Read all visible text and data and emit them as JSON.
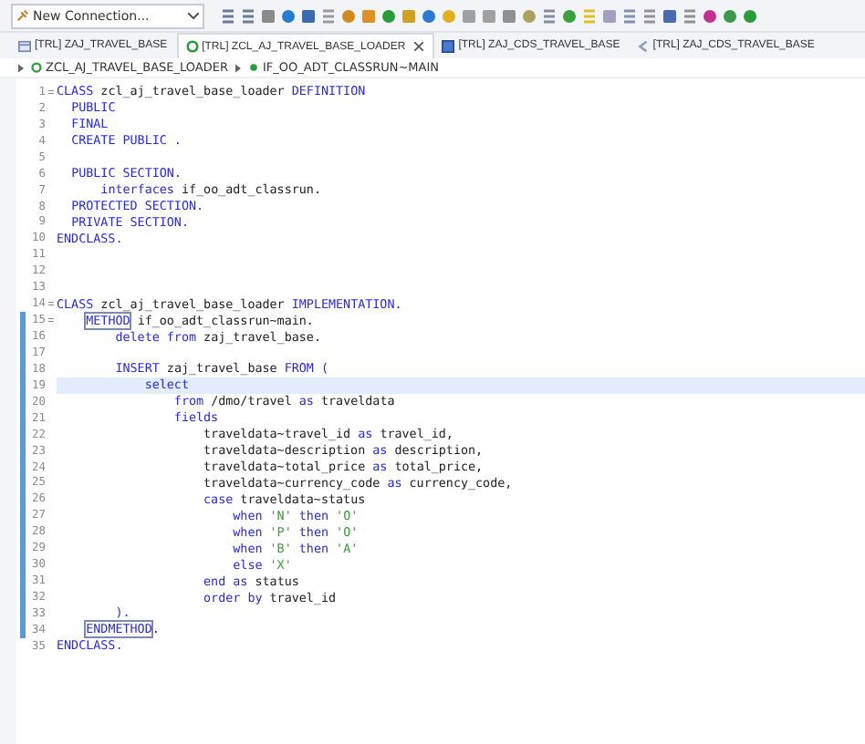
{
  "toolbar": {
    "connection": {
      "value": "New Connection..."
    }
  },
  "tabs": [
    {
      "label": "[TRL] ZAJ_TRAVEL_BASE",
      "kind": "table",
      "selected": false,
      "closable": false
    },
    {
      "label": "[TRL] ZCL_AJ_TRAVEL_BASE_LOADER",
      "kind": "class",
      "selected": true,
      "closable": true
    },
    {
      "label": "[TRL] ZAJ_CDS_TRAVEL_BASE",
      "kind": "cds",
      "selected": false,
      "closable": false
    },
    {
      "label": "[TRL] ZAJ_CDS_TRAVEL_BASE",
      "kind": "extension",
      "selected": false,
      "closable": false
    }
  ],
  "breadcrumb": [
    {
      "label": "ZCL_AJ_TRAVEL_BASE_LOADER",
      "kind": "class"
    },
    {
      "label": "IF_OO_ADT_CLASSRUN~MAIN",
      "kind": "method"
    }
  ],
  "editor": {
    "lines": [
      {
        "number": "1",
        "fold": true,
        "changed": false,
        "current": false,
        "tokens": [
          {
            "kind": "keyword",
            "text": "CLASS"
          },
          {
            "kind": "name",
            "text": " zcl_aj_travel_base_loader "
          },
          {
            "kind": "keyword",
            "text": "DEFINITION"
          }
        ]
      },
      {
        "number": "2",
        "fold": false,
        "changed": false,
        "current": false,
        "tokens": [
          {
            "kind": "keyword",
            "text": "  PUBLIC"
          }
        ]
      },
      {
        "number": "3",
        "fold": false,
        "changed": false,
        "current": false,
        "tokens": [
          {
            "kind": "keyword",
            "text": "  FINAL"
          }
        ]
      },
      {
        "number": "4",
        "fold": false,
        "changed": false,
        "current": false,
        "tokens": [
          {
            "kind": "keyword",
            "text": "  CREATE PUBLIC ."
          }
        ]
      },
      {
        "number": "5",
        "fold": false,
        "changed": false,
        "current": false
      },
      {
        "number": "6",
        "fold": false,
        "changed": false,
        "current": false,
        "tokens": [
          {
            "kind": "keyword",
            "text": "  PUBLIC SECTION."
          }
        ]
      },
      {
        "number": "7",
        "fold": false,
        "changed": false,
        "current": false,
        "tokens": [
          {
            "kind": "keyword",
            "text": "      interfaces"
          },
          {
            "kind": "name",
            "text": " if_oo_adt_classrun."
          }
        ]
      },
      {
        "number": "8",
        "fold": false,
        "changed": false,
        "current": false,
        "tokens": [
          {
            "kind": "keyword",
            "text": "  PROTECTED SECTION."
          }
        ]
      },
      {
        "number": "9",
        "fold": false,
        "changed": false,
        "current": false,
        "tokens": [
          {
            "kind": "keyword",
            "text": "  PRIVATE SECTION."
          }
        ]
      },
      {
        "number": "10",
        "fold": false,
        "changed": false,
        "current": false,
        "tokens": [
          {
            "kind": "keyword",
            "text": "ENDCLASS."
          }
        ]
      },
      {
        "number": "11",
        "fold": false,
        "changed": false,
        "current": false
      },
      {
        "number": "12",
        "fold": false,
        "changed": false,
        "current": false
      },
      {
        "number": "13",
        "fold": false,
        "changed": false,
        "current": false
      },
      {
        "number": "14",
        "fold": true,
        "changed": false,
        "current": false,
        "tokens": [
          {
            "kind": "keyword",
            "text": "CLASS"
          },
          {
            "kind": "name",
            "text": " zcl_aj_travel_base_loader "
          },
          {
            "kind": "keyword",
            "text": "IMPLEMENTATION."
          }
        ]
      },
      {
        "number": "15",
        "fold": true,
        "changed": true,
        "current": false,
        "tokens": [
          {
            "kind": "match",
            "text": "    METHOD"
          },
          {
            "kind": "name",
            "text": " if_oo_adt_classrun~main."
          }
        ]
      },
      {
        "number": "16",
        "fold": false,
        "changed": true,
        "current": false,
        "tokens": [
          {
            "kind": "keyword",
            "text": "        delete from"
          },
          {
            "kind": "name",
            "text": " zaj_travel_base."
          }
        ]
      },
      {
        "number": "17",
        "fold": false,
        "changed": true,
        "current": false
      },
      {
        "number": "18",
        "fold": false,
        "changed": true,
        "current": false,
        "tokens": [
          {
            "kind": "keyword",
            "text": "        INSERT"
          },
          {
            "kind": "name",
            "text": " zaj_travel_base "
          },
          {
            "kind": "keyword",
            "text": "FROM ("
          }
        ]
      },
      {
        "number": "19",
        "fold": false,
        "changed": true,
        "current": true,
        "tokens": [
          {
            "kind": "keyword",
            "text": "            select"
          }
        ]
      },
      {
        "number": "20",
        "fold": false,
        "changed": true,
        "current": false,
        "tokens": [
          {
            "kind": "keyword",
            "text": "                from"
          },
          {
            "kind": "name",
            "text": " /dmo/travel "
          },
          {
            "kind": "keyword",
            "text": "as"
          },
          {
            "kind": "name",
            "text": " traveldata"
          }
        ]
      },
      {
        "number": "21",
        "fold": false,
        "changed": true,
        "current": false,
        "tokens": [
          {
            "kind": "keyword",
            "text": "                fields"
          }
        ]
      },
      {
        "number": "22",
        "fold": false,
        "changed": true,
        "current": false,
        "tokens": [
          {
            "kind": "name",
            "text": "                    traveldata~travel_id "
          },
          {
            "kind": "keyword",
            "text": "as"
          },
          {
            "kind": "name",
            "text": " travel_id,"
          }
        ]
      },
      {
        "number": "23",
        "fold": false,
        "changed": true,
        "current": false,
        "tokens": [
          {
            "kind": "name",
            "text": "                    traveldata~description "
          },
          {
            "kind": "keyword",
            "text": "as"
          },
          {
            "kind": "name",
            "text": " description,"
          }
        ]
      },
      {
        "number": "24",
        "fold": false,
        "changed": true,
        "current": false,
        "tokens": [
          {
            "kind": "name",
            "text": "                    traveldata~total_price "
          },
          {
            "kind": "keyword",
            "text": "as"
          },
          {
            "kind": "name",
            "text": " total_price,"
          }
        ]
      },
      {
        "number": "25",
        "fold": false,
        "changed": true,
        "current": false,
        "tokens": [
          {
            "kind": "name",
            "text": "                    traveldata~currency_code "
          },
          {
            "kind": "keyword",
            "text": "as"
          },
          {
            "kind": "name",
            "text": " currency_code,"
          }
        ]
      },
      {
        "number": "26",
        "fold": false,
        "changed": true,
        "current": false,
        "tokens": [
          {
            "kind": "keyword",
            "text": "                    case"
          },
          {
            "kind": "name",
            "text": " traveldata~status"
          }
        ]
      },
      {
        "number": "27",
        "fold": false,
        "changed": true,
        "current": false,
        "tokens": [
          {
            "kind": "keyword",
            "text": "                        when "
          },
          {
            "kind": "string",
            "text": "'N'"
          },
          {
            "kind": "keyword",
            "text": " then "
          },
          {
            "kind": "string",
            "text": "'O'"
          }
        ]
      },
      {
        "number": "28",
        "fold": false,
        "changed": true,
        "current": false,
        "tokens": [
          {
            "kind": "keyword",
            "text": "                        when "
          },
          {
            "kind": "string",
            "text": "'P'"
          },
          {
            "kind": "keyword",
            "text": " then "
          },
          {
            "kind": "string",
            "text": "'O'"
          }
        ]
      },
      {
        "number": "29",
        "fold": false,
        "changed": true,
        "current": false,
        "tokens": [
          {
            "kind": "keyword",
            "text": "                        when "
          },
          {
            "kind": "string",
            "text": "'B'"
          },
          {
            "kind": "keyword",
            "text": " then "
          },
          {
            "kind": "string",
            "text": "'A'"
          }
        ]
      },
      {
        "number": "30",
        "fold": false,
        "changed": true,
        "current": false,
        "tokens": [
          {
            "kind": "keyword",
            "text": "                        else "
          },
          {
            "kind": "string",
            "text": "'X'"
          }
        ]
      },
      {
        "number": "31",
        "fold": false,
        "changed": true,
        "current": false,
        "tokens": [
          {
            "kind": "keyword",
            "text": "                    end as"
          },
          {
            "kind": "name",
            "text": " status"
          }
        ]
      },
      {
        "number": "32",
        "fold": false,
        "changed": true,
        "current": false,
        "tokens": [
          {
            "kind": "keyword",
            "text": "                    order by"
          },
          {
            "kind": "name",
            "text": " travel_id"
          }
        ]
      },
      {
        "number": "33",
        "fold": false,
        "changed": true,
        "current": false,
        "tokens": [
          {
            "kind": "keyword",
            "text": "        )."
          }
        ]
      },
      {
        "number": "34",
        "fold": false,
        "changed": true,
        "current": false,
        "tokens": [
          {
            "kind": "match",
            "text": "    ENDMETHOD"
          },
          {
            "kind": "name",
            "text": "."
          }
        ]
      },
      {
        "number": "35",
        "fold": false,
        "changed": false,
        "current": false,
        "tokens": [
          {
            "kind": "keyword",
            "text": "ENDCLASS."
          }
        ]
      }
    ]
  }
}
